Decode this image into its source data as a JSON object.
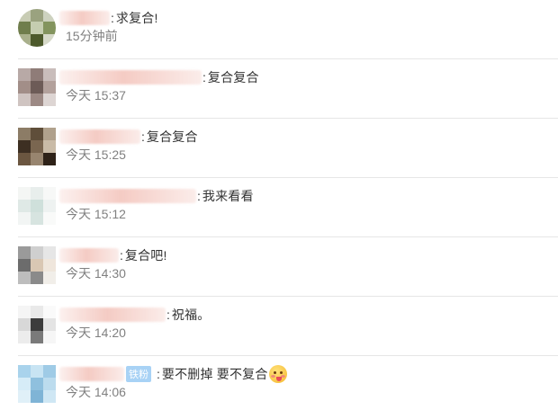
{
  "comments": [
    {
      "avatar_colors": [
        "#c8ccb4",
        "#9aa27f",
        "#cdd2bf",
        "#6f7d4c",
        "#c5cdb0",
        "#83945e",
        "#a9b08c",
        "#4d5a2c",
        "#d6d9c9"
      ],
      "message": "求复合!",
      "time": "15分钟前",
      "badge": "",
      "emoji": ""
    },
    {
      "avatar_colors": [
        "#b8a9a6",
        "#8f7c78",
        "#c9bdbb",
        "#a28e88",
        "#6d5b57",
        "#b3a19c",
        "#cfc4c1",
        "#9c8984",
        "#ddd5d3"
      ],
      "message": "复合复合",
      "time": "今天 15:37",
      "badge": "",
      "emoji": ""
    },
    {
      "avatar_colors": [
        "#8c7c66",
        "#5f4e3a",
        "#b0a18c",
        "#3d2f22",
        "#7a6650",
        "#c9bba7",
        "#6b5640",
        "#98856f",
        "#2e2218"
      ],
      "message": "复合复合",
      "time": "今天 15:25",
      "badge": "",
      "emoji": ""
    },
    {
      "avatar_colors": [
        "#f4f6f4",
        "#e8eeec",
        "#f7f8f7",
        "#dfe9e6",
        "#cfe0db",
        "#eef2f1",
        "#f2f5f4",
        "#d7e4e0",
        "#f9faf9"
      ],
      "message": "我来看看",
      "time": "今天 15:12",
      "badge": "",
      "emoji": ""
    },
    {
      "avatar_colors": [
        "#9a9a9a",
        "#cfcfcf",
        "#e6e6e6",
        "#6c6c6c",
        "#d9c7b3",
        "#efe6dc",
        "#bdbdbd",
        "#8a8a8a",
        "#f1eee9"
      ],
      "message": "复合吧!",
      "time": "今天 14:30",
      "badge": "",
      "emoji": ""
    },
    {
      "avatar_colors": [
        "#f5f5f5",
        "#e9e9e9",
        "#fafafa",
        "#d8d8d8",
        "#3c3c3c",
        "#e4e4e4",
        "#ececec",
        "#7a7a7a",
        "#f6f6f6"
      ],
      "message": "祝福。",
      "time": "今天 14:20",
      "badge": "",
      "emoji": ""
    },
    {
      "avatar_colors": [
        "#a9d3ec",
        "#c8e4f3",
        "#9fcbe6",
        "#d6ecf7",
        "#8fc0de",
        "#bcdcee",
        "#e0f0f8",
        "#7fb4d6",
        "#cfe7f4"
      ],
      "message": "要不删掉 要不复合",
      "time": "今天 14:06",
      "badge": "铁粉",
      "emoji": "smiling-face-with-tongue"
    }
  ]
}
